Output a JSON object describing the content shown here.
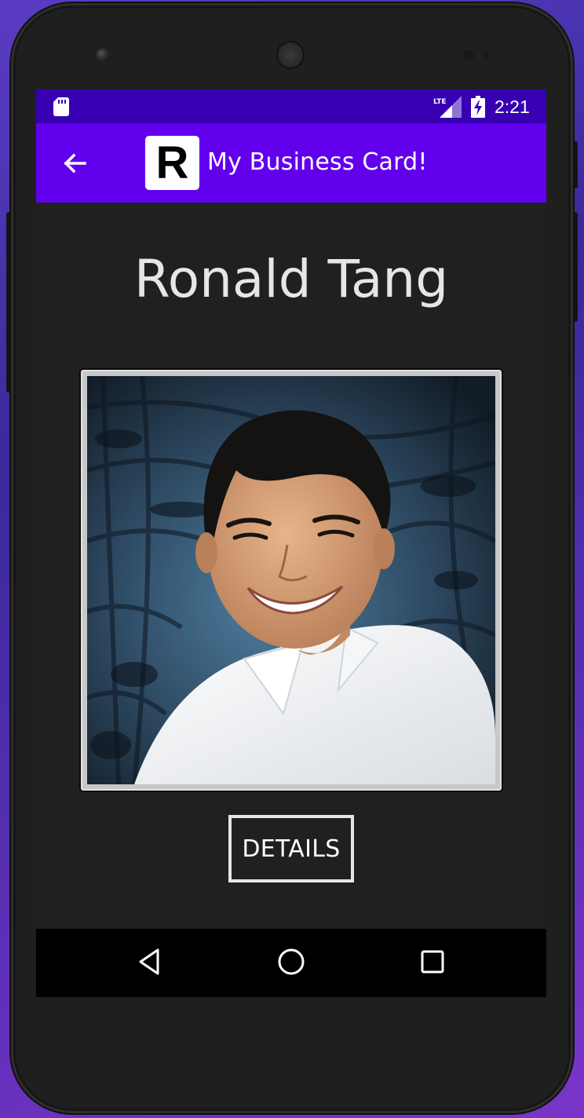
{
  "status_bar": {
    "time": "2:21",
    "network_label": "LTE",
    "icons": [
      "sd-card-icon",
      "signal-icon",
      "battery-charging-icon"
    ]
  },
  "app_bar": {
    "logo_letter": "R",
    "title": "My Business Card!",
    "back_icon": "arrow-left-icon"
  },
  "card": {
    "name": "Ronald Tang",
    "details_button_label": "DETAILS"
  },
  "nav_bar": {
    "icons": [
      "triangle-back-icon",
      "circle-home-icon",
      "square-recents-icon"
    ]
  },
  "colors": {
    "status_bar": "#3700b3",
    "app_bar": "#6200ee",
    "screen_background": "#202020",
    "nav_bar": "#000000",
    "text": "#e6e6e6"
  }
}
